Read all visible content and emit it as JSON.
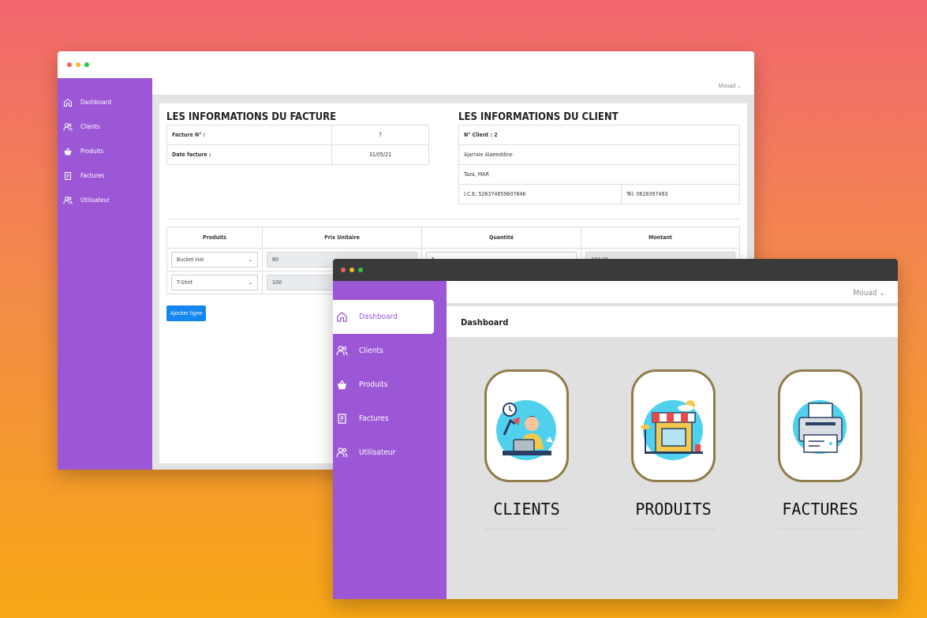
{
  "back_window": {
    "user_menu": "Mouad",
    "sidebar": [
      {
        "label": "Dashboard",
        "icon": "home-icon"
      },
      {
        "label": "Clients",
        "icon": "users-icon"
      },
      {
        "label": "Produits",
        "icon": "basket-icon"
      },
      {
        "label": "Factures",
        "icon": "invoice-icon"
      },
      {
        "label": "Utilisateur",
        "icon": "users-icon"
      }
    ],
    "facture": {
      "title": "LES INFORMATIONS DU FACTURE",
      "num_label": "Facture N° :",
      "num_value": "7",
      "date_label": "Date facture :",
      "date_value": "31/05/21"
    },
    "client": {
      "title": "LES INFORMATIONS DU CLIENT",
      "num_label": "N° Client : 2",
      "name": "Ajarraie Alaeeddine",
      "city": "Taza, MAR",
      "ice": "I.C.E: 526374859607846",
      "tel": "Tél: 0628397493"
    },
    "lines": {
      "headers": [
        "Produits",
        "Prix Unitaire",
        "Quantité",
        "Montant"
      ],
      "rows": [
        {
          "product": "Bucket Hat",
          "price": "80",
          "qty": "5",
          "amount": "400.00"
        },
        {
          "product": "T-Shirt",
          "price": "100",
          "qty": "",
          "amount": ""
        }
      ]
    },
    "add_button": "Ajouter ligne"
  },
  "front_window": {
    "user_menu": "Mouad",
    "header": "Dashboard",
    "sidebar": [
      {
        "label": "Dashboard",
        "icon": "home-icon",
        "active": true
      },
      {
        "label": "Clients",
        "icon": "users-icon"
      },
      {
        "label": "Produits",
        "icon": "basket-icon"
      },
      {
        "label": "Factures",
        "icon": "invoice-icon"
      },
      {
        "label": "Utilisateur",
        "icon": "users-icon"
      }
    ],
    "tiles": [
      {
        "label": "CLIENTS",
        "icon": "person-at-desk-illustration"
      },
      {
        "label": "PRODUITS",
        "icon": "shop-front-illustration"
      },
      {
        "label": "FACTURES",
        "icon": "printer-illustration"
      }
    ]
  },
  "colors": {
    "sidebar": "#9b57d6",
    "primary_button": "#1487f0",
    "tile_border": "#8e7c4b"
  }
}
